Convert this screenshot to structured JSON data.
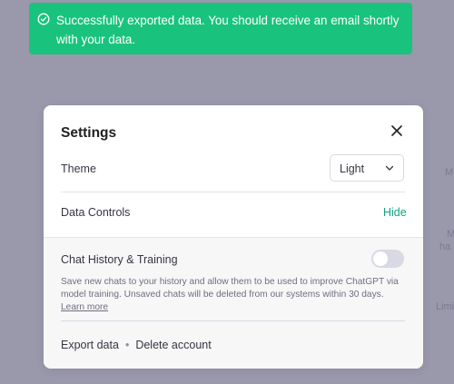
{
  "background": {
    "ghost_texts": [
      "M",
      "M",
      "ha",
      "Limi",
      "·"
    ]
  },
  "toast": {
    "message": "Successfully exported data. You should receive an email shortly with your data.",
    "icon": "check-circle-icon",
    "color": "#19c37d"
  },
  "modal": {
    "title": "Settings",
    "close_icon": "close-icon",
    "theme": {
      "label": "Theme",
      "selected": "Light",
      "icon": "chevron-down-icon"
    },
    "data_controls": {
      "label": "Data Controls",
      "toggle_link": "Hide"
    },
    "chat_history": {
      "label": "Chat History & Training",
      "enabled": false,
      "description": "Save new chats to your history and allow them to be used to improve ChatGPT via model training. Unsaved chats will be deleted from our systems within 30 days.",
      "learn_more": "Learn more"
    },
    "actions": {
      "export": "Export data",
      "separator": "•",
      "delete": "Delete account"
    }
  },
  "colors": {
    "accent": "#10a37f",
    "toast_bg": "#19c37d",
    "overlay": "#9a98ab"
  }
}
